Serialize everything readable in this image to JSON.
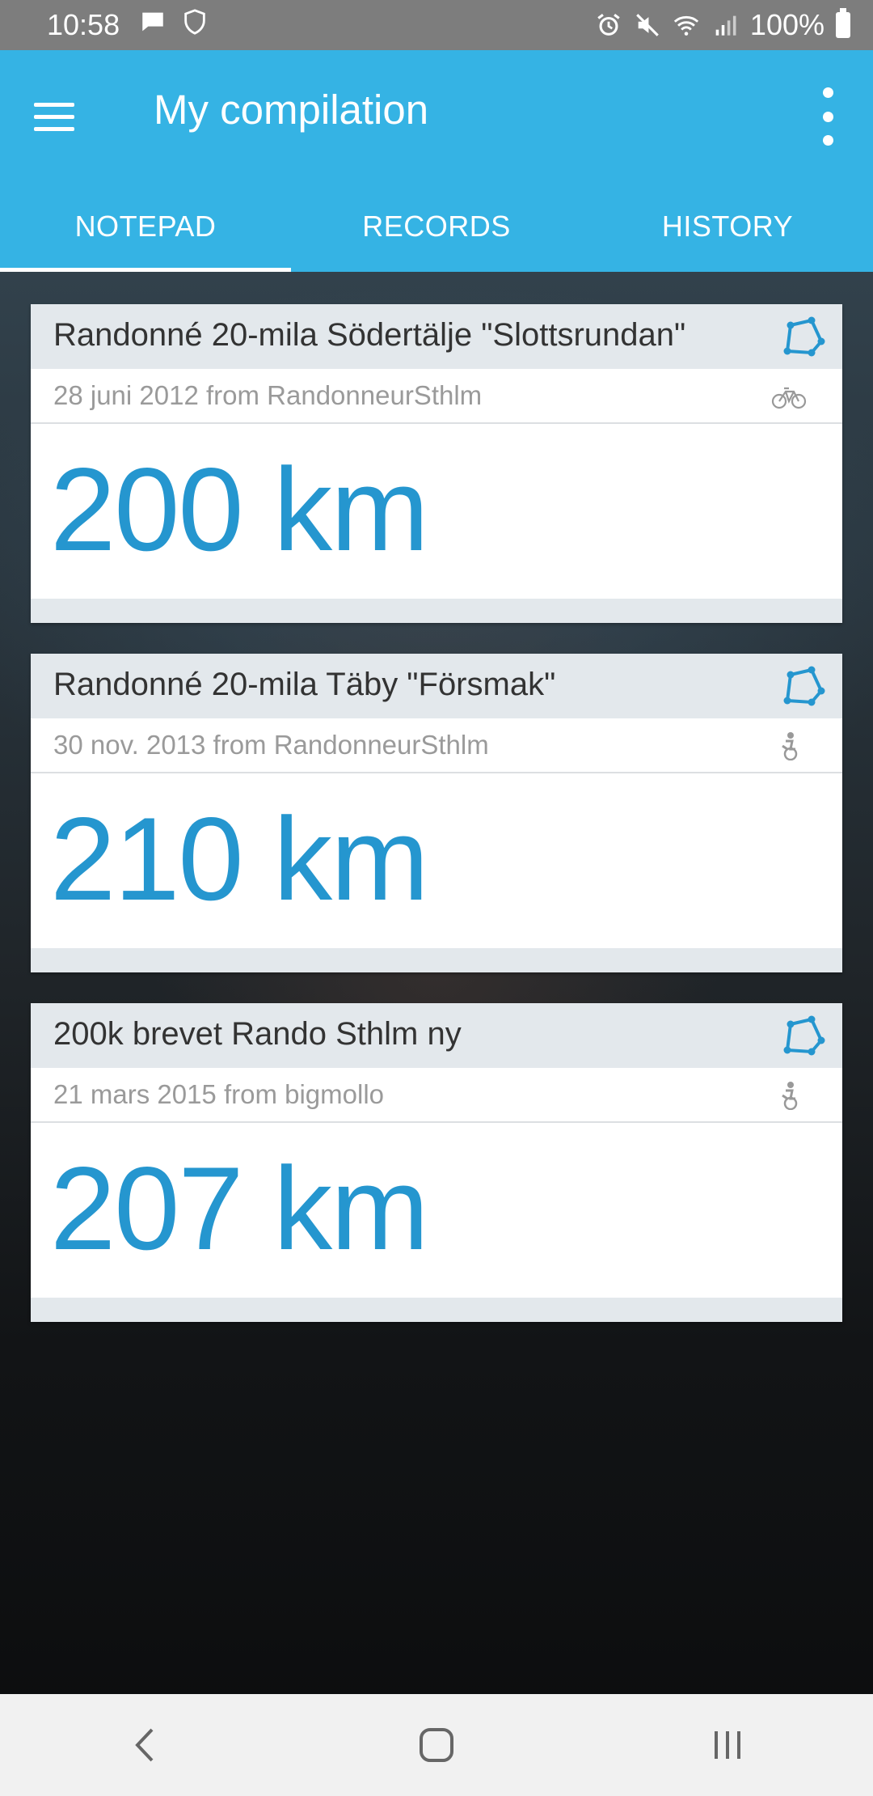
{
  "status_bar": {
    "time": "10:58",
    "battery_text": "100%",
    "icons": [
      "chat-icon",
      "shield-icon",
      "alarm-icon",
      "mute-icon",
      "wifi-icon",
      "signal-icon",
      "battery-icon"
    ]
  },
  "app_bar": {
    "title": "My compilation",
    "menu_icon": "hamburger-menu-icon",
    "overflow_icon": "more-vert-icon",
    "color": "#35b3e4"
  },
  "tabs": [
    {
      "label": "NOTEPAD",
      "active": true
    },
    {
      "label": "RECORDS",
      "active": false
    },
    {
      "label": "HISTORY",
      "active": false
    }
  ],
  "cards": [
    {
      "title": "Randonné 20-mila Södertälje \"Slottsrundan\"",
      "date_line": "28 juni 2012 from RandonneurSthlm",
      "distance": "200 km",
      "sport_icon": "bicycle-icon",
      "route_icon": "route-icon"
    },
    {
      "title": "Randonné 20-mila Täby \"Försmak\"",
      "date_line": "30 nov. 2013 from RandonneurSthlm",
      "distance": "210 km",
      "sport_icon": "cyclist-icon",
      "route_icon": "route-icon"
    },
    {
      "title": "200k brevet Rando Sthlm ny",
      "date_line": "21 mars 2015 from bigmollo",
      "distance": "207 km",
      "sport_icon": "cyclist-icon",
      "route_icon": "route-icon"
    }
  ],
  "nav_bar": {
    "buttons": [
      "back-icon",
      "home-icon",
      "recents-icon"
    ]
  },
  "colors": {
    "accent": "#35b3e4",
    "distance": "#2596cf",
    "card_header": "#e3e8ec"
  }
}
